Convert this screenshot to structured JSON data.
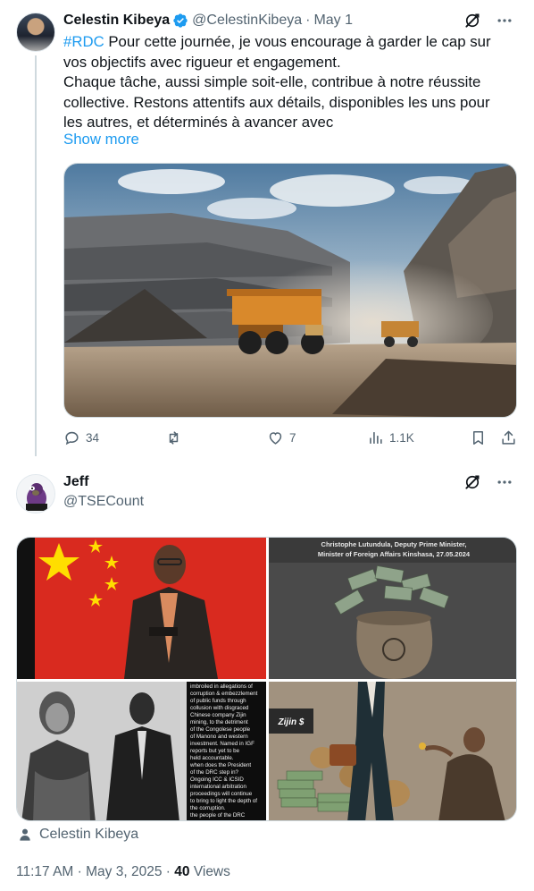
{
  "parent_tweet": {
    "author_name": "Celestin Kibeya",
    "handle": "@CelestinKibeya",
    "separator": "·",
    "date": "May 1",
    "hashtag": "#RDC",
    "text_line1_rest": " Pour cette  journée, je vous encourage à garder le cap sur",
    "text_line2": "vos objectifs avec rigueur et engagement.",
    "text_line3": "Chaque tâche, aussi simple soit-elle, contribue à notre réussite",
    "text_line4": "collective. Restons attentifs aux détails, disponibles les uns pour",
    "text_line5": "les autres, et déterminés à avancer avec",
    "show_more": "Show more",
    "actions": {
      "replies": "34",
      "reposts": "",
      "likes": "7",
      "views": "1.1K"
    },
    "icons": [
      "verified-badge-icon",
      "grok-icon",
      "more-icon",
      "reply-icon",
      "repost-icon",
      "like-icon",
      "views-icon",
      "bookmark-icon",
      "share-icon"
    ]
  },
  "reply_tweet": {
    "author_name": "Jeff",
    "handle": "@TSECount",
    "image2_caption_line1": "Christophe Lutundula, Deputy Prime Minister,",
    "image2_caption_line2": "Minister of Foreign Affairs  Kinshasa, 27.05.2024",
    "image3_text": [
      "imbroiled in allegations of",
      "corruption & embezzlement",
      "of public funds through",
      "collusion with disgraced",
      "Chinese company Zijin",
      "mining, to the detriment",
      "of the Congolese people",
      "of Manono and western",
      "investment. Named in IGF",
      "reports but yet to be",
      "held accountable.",
      "when does the President",
      "of the DRC step in?",
      "Ongoing ICC & ICSID",
      "international arbitration",
      "proceedings will continue",
      "to bring to light the depth of",
      "the corruption.",
      "the people of the DRC"
    ],
    "image4_label": "Zijin $",
    "tagged_user": "Celestin Kibeya",
    "time": "11:17 AM",
    "sep": "·",
    "post_date": "May 3, 2025",
    "views_count": "40",
    "views_label": "Views"
  },
  "colors": {
    "link_blue": "#1d9bf0",
    "secondary_text": "#536471",
    "primary_text": "#0f1419",
    "border": "#cfd9de"
  }
}
